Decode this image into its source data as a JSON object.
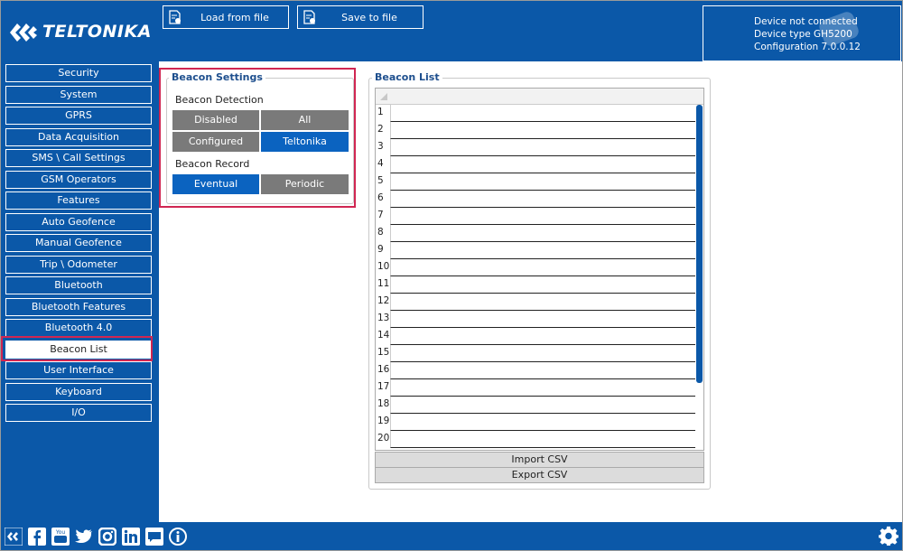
{
  "header": {
    "logo_text": "TELTONIKA",
    "load_button": "Load from file",
    "save_button": "Save to file",
    "device": {
      "status": "Device not connected",
      "type": "Device type GH5200",
      "configuration": "Configuration 7.0.0.12"
    }
  },
  "sidebar": {
    "items": [
      {
        "label": "Security"
      },
      {
        "label": "System"
      },
      {
        "label": "GPRS"
      },
      {
        "label": "Data Acquisition"
      },
      {
        "label": "SMS \\ Call Settings"
      },
      {
        "label": "GSM Operators"
      },
      {
        "label": "Features"
      },
      {
        "label": "Auto Geofence"
      },
      {
        "label": "Manual Geofence"
      },
      {
        "label": "Trip \\ Odometer"
      },
      {
        "label": "Bluetooth"
      },
      {
        "label": "Bluetooth Features"
      },
      {
        "label": "Bluetooth 4.0"
      },
      {
        "label": "Beacon List"
      },
      {
        "label": "User Interface"
      },
      {
        "label": "Keyboard"
      },
      {
        "label": "I/O"
      }
    ],
    "active": "Beacon List"
  },
  "beacon_settings": {
    "title": "Beacon Settings",
    "detection_label": "Beacon Detection",
    "detection_options": [
      "Disabled",
      "All",
      "Configured",
      "Teltonika"
    ],
    "detection_selected": "Teltonika",
    "record_label": "Beacon Record",
    "record_options": [
      "Eventual",
      "Periodic"
    ],
    "record_selected": "Eventual"
  },
  "beacon_list": {
    "title": "Beacon List",
    "row_numbers": [
      "1",
      "2",
      "3",
      "4",
      "5",
      "6",
      "7",
      "8",
      "9",
      "10",
      "11",
      "12",
      "13",
      "14",
      "15",
      "16",
      "17",
      "18",
      "19",
      "20"
    ],
    "import_button": "Import CSV",
    "export_button": "Export CSV"
  },
  "footer": {
    "icons": [
      "teltonika-icon",
      "facebook-icon",
      "youtube-icon",
      "twitter-icon",
      "instagram-icon",
      "linkedin-icon",
      "chat-icon",
      "info-icon"
    ],
    "settings_icon": "gear-icon"
  },
  "colors": {
    "brand_blue": "#0b58a8",
    "selected_blue": "#0b63c0",
    "unselected_gray": "#7a7a7a",
    "highlight": "#d02652"
  }
}
